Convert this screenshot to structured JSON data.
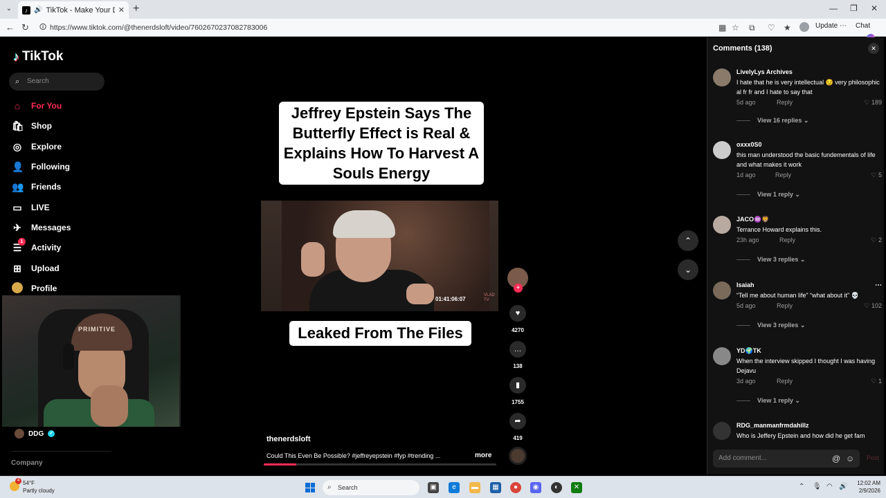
{
  "browser": {
    "tab_title": "TikTok - Make Your Day",
    "url": "https://www.tiktok.com/@thenerdsloft/video/7602670237082783006",
    "update_label": "Update",
    "chat_label": "Chat"
  },
  "sidebar": {
    "logo_text": "TikTok",
    "search_placeholder": "Search",
    "items": [
      {
        "label": "For You",
        "icon": "home-icon"
      },
      {
        "label": "Shop",
        "icon": "shop-icon"
      },
      {
        "label": "Explore",
        "icon": "compass-icon"
      },
      {
        "label": "Following",
        "icon": "following-icon"
      },
      {
        "label": "Friends",
        "icon": "friends-icon"
      },
      {
        "label": "LIVE",
        "icon": "live-icon"
      },
      {
        "label": "Messages",
        "icon": "messages-icon"
      },
      {
        "label": "Activity",
        "icon": "activity-icon",
        "badge": "1"
      },
      {
        "label": "Upload",
        "icon": "upload-icon"
      },
      {
        "label": "Profile",
        "icon": "profile-icon"
      }
    ],
    "following_account": "DDG",
    "company_label": "Company"
  },
  "webcam": {
    "beanie_text": "PRIMITIVE"
  },
  "video": {
    "caption": "Jeffrey Epstein Says The Butterfly Effect is Real & Explains How To Harvest A Souls Energy",
    "timestamp": "01:41:06:07",
    "watermark": "VLAD TV",
    "bottom_text": "Leaked From The Files",
    "author": "thenerdsloft",
    "description": "Could This Even Be Possible? #jeffreyepstein #fyp #trending ...",
    "more_label": "more",
    "progress_fraction": 0.14
  },
  "actions": {
    "likes": "4270",
    "comments": "138",
    "saves": "1755",
    "shares": "419"
  },
  "comments_panel": {
    "title": "Comments (138)",
    "add_placeholder": "Add comment...",
    "post_label": "Post",
    "items": [
      {
        "user": "LivelyLys Archives",
        "text": "I hate that he is very intellectual 😏 very philosophical fr fr and I hate to say that",
        "time": "5d ago",
        "reply": "Reply",
        "likes": "189",
        "view": "View 16 replies"
      },
      {
        "user": "oxxx0S0",
        "text": "this man understood the basic fundementals of life and what makes it work",
        "time": "1d ago",
        "reply": "Reply",
        "likes": "5",
        "view": "View 1 reply"
      },
      {
        "user": "JACO♒🦁",
        "text": "Terrance Howard explains this.",
        "time": "23h ago",
        "reply": "Reply",
        "likes": "2",
        "view": "View 3 replies"
      },
      {
        "user": "Isaiah",
        "text": "“Tell me about human life” “what about it” 💀",
        "time": "5d ago",
        "reply": "Reply",
        "likes": "102",
        "view": "View 3 replies"
      },
      {
        "user": "YD🌍TK",
        "text": "When the interview skipped I thought I was having Dejavu",
        "time": "3d ago",
        "reply": "Reply",
        "likes": "1",
        "view": "View 1 reply"
      },
      {
        "user": "RDG_manmanfrmdahillz",
        "text": "Who is Jeffery Epstein and how did he get fam"
      }
    ]
  },
  "taskbar": {
    "temp": "54°F",
    "weather": "Partly cloudy",
    "weather_badge": "4",
    "search_label": "Search",
    "time": "12:02 AM",
    "date": "2/9/2026"
  }
}
